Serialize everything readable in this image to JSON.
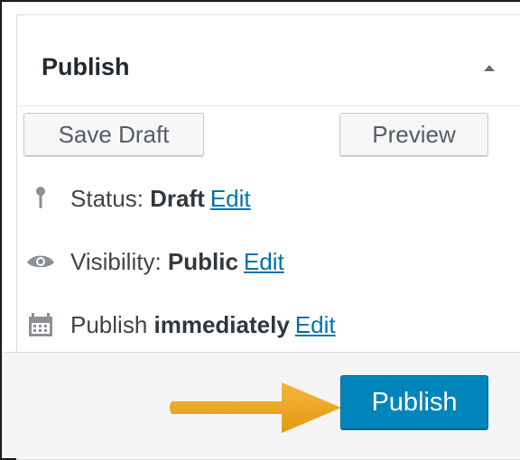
{
  "publish_box": {
    "title": "Publish",
    "toggle_icon": "collapse-arrow-icon",
    "save_draft_label": "Save Draft",
    "preview_label": "Preview",
    "status": {
      "icon": "pin-icon",
      "label": "Status: ",
      "value": "Draft",
      "edit_label": "Edit"
    },
    "visibility": {
      "icon": "eye-icon",
      "label": "Visibility: ",
      "value": "Public",
      "edit_label": "Edit"
    },
    "schedule": {
      "icon": "calendar-icon",
      "label": "Publish ",
      "value": "immediately",
      "edit_label": "Edit"
    },
    "publish_label": "Publish"
  },
  "annotation": {
    "icon": "pointer-arrow-icon",
    "color": "#f0a722"
  },
  "colors": {
    "primary": "#0085ba",
    "link": "#0073aa",
    "footer_bg": "#f5f5f5"
  }
}
